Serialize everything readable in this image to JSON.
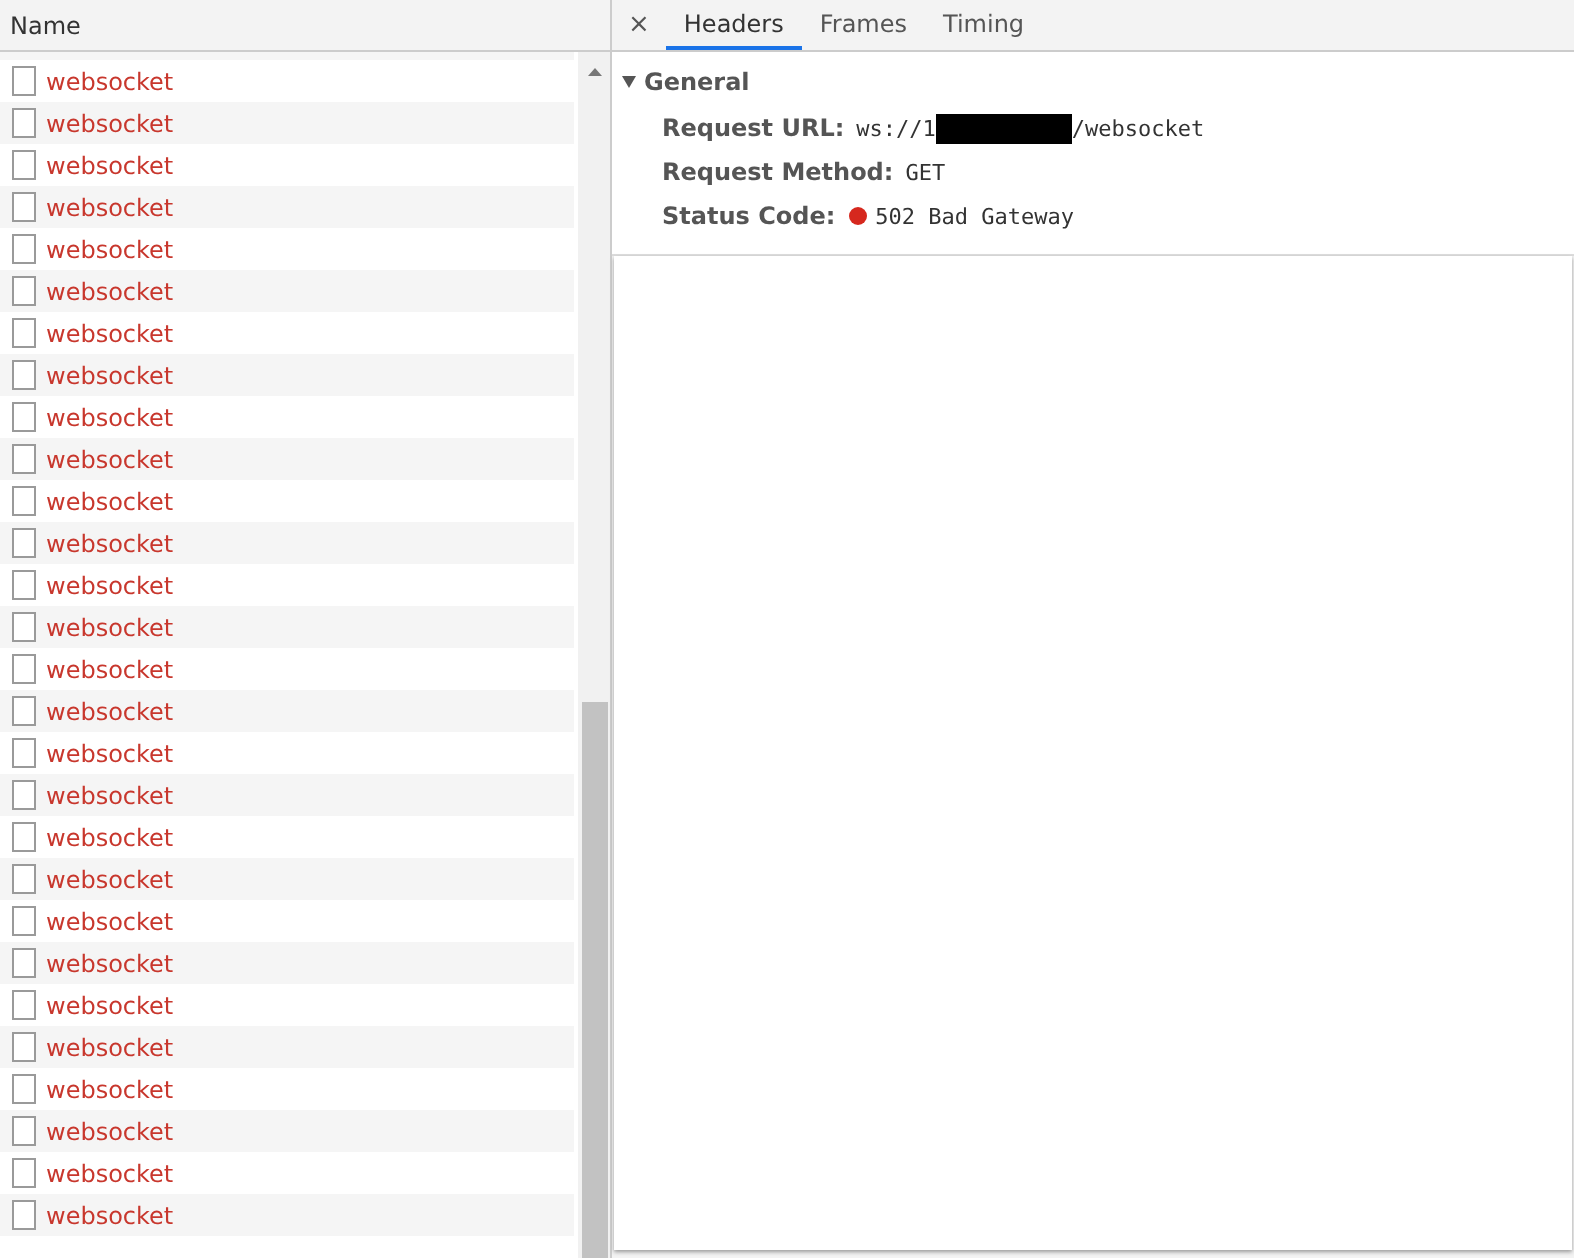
{
  "requests": {
    "column": "Name",
    "rows": [
      {
        "name": "websocket"
      },
      {
        "name": "websocket"
      },
      {
        "name": "websocket"
      },
      {
        "name": "websocket"
      },
      {
        "name": "websocket"
      },
      {
        "name": "websocket"
      },
      {
        "name": "websocket"
      },
      {
        "name": "websocket"
      },
      {
        "name": "websocket"
      },
      {
        "name": "websocket"
      },
      {
        "name": "websocket"
      },
      {
        "name": "websocket"
      },
      {
        "name": "websocket"
      },
      {
        "name": "websocket"
      },
      {
        "name": "websocket"
      },
      {
        "name": "websocket"
      },
      {
        "name": "websocket"
      },
      {
        "name": "websocket"
      },
      {
        "name": "websocket"
      },
      {
        "name": "websocket"
      },
      {
        "name": "websocket"
      },
      {
        "name": "websocket"
      },
      {
        "name": "websocket"
      },
      {
        "name": "websocket"
      },
      {
        "name": "websocket"
      },
      {
        "name": "websocket"
      },
      {
        "name": "websocket"
      },
      {
        "name": "websocket"
      }
    ]
  },
  "details": {
    "close": "×",
    "tabs": [
      {
        "label": "Headers",
        "selected": true
      },
      {
        "label": "Frames",
        "selected": false
      },
      {
        "label": "Timing",
        "selected": false
      }
    ],
    "section": {
      "title": "General",
      "expanded": true,
      "fields": [
        {
          "kind": "redacted",
          "label": "Request URL:",
          "value_start": "ws://1",
          "value_end": "/websocket"
        },
        {
          "kind": "plain",
          "label": "Request Method:",
          "value": "GET"
        },
        {
          "kind": "status",
          "label": "Status Code:",
          "value": "502 Bad Gateway"
        }
      ]
    }
  }
}
